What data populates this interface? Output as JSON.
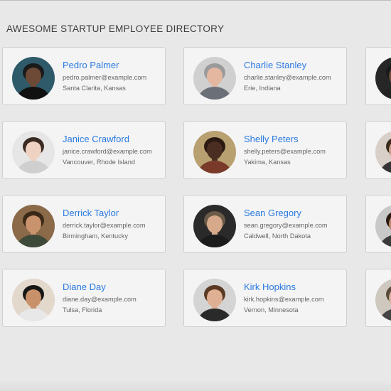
{
  "header": {
    "title": "AWESOME STARTUP EMPLOYEE DIRECTORY"
  },
  "employees": [
    {
      "name": "Pedro Palmer",
      "email": "pedro.palmer@example.com",
      "location": "Santa Clarita, Kansas",
      "skin": "#6d4a36",
      "hair": "#1a1a1a",
      "bg": "#2e5a6a",
      "shirt": "#111111"
    },
    {
      "name": "Charlie Stanley",
      "email": "charlie.stanley@example.com",
      "location": "Erie, Indiana",
      "skin": "#e3b7a0",
      "hair": "#9a9a9a",
      "bg": "#d0d0d0",
      "shirt": "#6b6f77"
    },
    {
      "name": "Janice Crawford",
      "email": "janice.crawford@example.com",
      "location": "Vancouver, Rhode Island",
      "skin": "#efd2c1",
      "hair": "#3a2a22",
      "bg": "#e6e6e6",
      "shirt": "#cfcfcf"
    },
    {
      "name": "Shelly Peters",
      "email": "shelly.peters@example.com",
      "location": "Yakima, Kansas",
      "skin": "#4b2e22",
      "hair": "#2a1a12",
      "bg": "#b8a070",
      "shirt": "#7a3a2a"
    },
    {
      "name": "Derrick Taylor",
      "email": "derrick.taylor@example.com",
      "location": "Birmingham, Kentucky",
      "skin": "#c9936e",
      "hair": "#3a2818",
      "bg": "#8a6a48",
      "shirt": "#3d4a3a"
    },
    {
      "name": "Sean Gregory",
      "email": "sean.gregory@example.com",
      "location": "Caldwell, North Dakota",
      "skin": "#d6a98a",
      "hair": "#6b5a48",
      "bg": "#2a2a2a",
      "shirt": "#1c1c1c"
    },
    {
      "name": "Diane Day",
      "email": "diane.day@example.com",
      "location": "Tulsa, Florida",
      "skin": "#c8916a",
      "hair": "#161616",
      "bg": "#e2d8cc",
      "shirt": "#e8e8e8"
    },
    {
      "name": "Kirk Hopkins",
      "email": "kirk.hopkins@example.com",
      "location": "Vernon, Minnesota",
      "skin": "#e0b094",
      "hair": "#5a3a22",
      "bg": "#d4d4d4",
      "shirt": "#2a2a2a"
    }
  ],
  "partial_avatars": [
    {
      "skin": "#6a4a3a",
      "hair": "#1a1a1a",
      "bg": "#262626",
      "shirt": "#222222"
    },
    {
      "skin": "#c9a088",
      "hair": "#3a2a1a",
      "bg": "#d8d0c8",
      "shirt": "#333333"
    },
    {
      "skin": "#b98a6a",
      "hair": "#2a1a10",
      "bg": "#c8c8c8",
      "shirt": "#3a3a3a"
    },
    {
      "skin": "#d6b09a",
      "hair": "#5a4a38",
      "bg": "#cfc8bf",
      "shirt": "#444444"
    }
  ]
}
